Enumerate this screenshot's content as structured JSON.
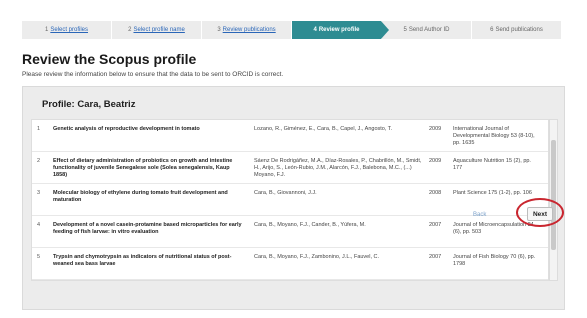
{
  "steps": [
    {
      "num": "1",
      "label": "Select profiles",
      "link": true
    },
    {
      "num": "2",
      "label": "Select profile name",
      "link": true
    },
    {
      "num": "3",
      "label": "Review publications",
      "link": true
    },
    {
      "num": "4",
      "label": "Review profile",
      "link": false,
      "active": true
    },
    {
      "num": "5",
      "label": "Send Author ID",
      "link": false
    },
    {
      "num": "6",
      "label": "Send publications",
      "link": false
    }
  ],
  "page": {
    "title": "Review the Scopus profile",
    "subtitle": "Please review the information below to ensure that the data to be sent to ORCID is correct."
  },
  "profile": {
    "heading": "Profile: Cara, Beatriz",
    "publications": [
      {
        "index": "1",
        "title": "Genetic analysis of reproductive development in tomato",
        "authors": "Lozano, R., Giménez, E., Cara, B., Capel, J., Angosto, T.",
        "year": "2009",
        "journal": "International Journal of Developmental Biology 53 (8-10), pp. 1635"
      },
      {
        "index": "2",
        "title": "Effect of dietary administration of probiotics on growth and intestine functionality of juvenile Senegalese sole (Solea senegalensis, Kaup 1858)",
        "authors": "Sáenz De Rodrigáñez, M.A., Díaz-Rosales, P., Chabrillón, M., Smidt, H., Arijo, S., León-Rubio, J.M., Alarcón, F.J., Balebona, M.C., (...) Moyano, F.J.",
        "year": "2009",
        "journal": "Aquaculture Nutrition 15 (2), pp. 177"
      },
      {
        "index": "3",
        "title": "Molecular biology of ethylene during tomato fruit development and maturation",
        "authors": "Cara, B., Giovannoni, J.J.",
        "year": "2008",
        "journal": "Plant Science 175 (1-2), pp. 106"
      },
      {
        "index": "4",
        "title": "Development of a novel casein-protamine based microparticles for early feeding of fish larvae: in vitro evaluation",
        "authors": "Cara, B., Moyano, F.J., Cander, B., Yúfera, M.",
        "year": "2007",
        "journal": "Journal of Microencapsulation 24 (6), pp. 503"
      },
      {
        "index": "5",
        "title": "Trypsin and chymotrypsin as indicators of nutritional status of post-weaned sea bass larvae",
        "authors": "Cara, B., Moyano, F.J., Zambonino, J.L., Fauvel, C.",
        "year": "2007",
        "journal": "Journal of Fish Biology 70 (6), pp. 1798"
      }
    ]
  },
  "nav": {
    "back_label": "Back",
    "next_label": "Next"
  },
  "colors": {
    "active_step": "#2e8c92",
    "link": "#2a66b8",
    "highlight_ring": "#c9262f"
  }
}
